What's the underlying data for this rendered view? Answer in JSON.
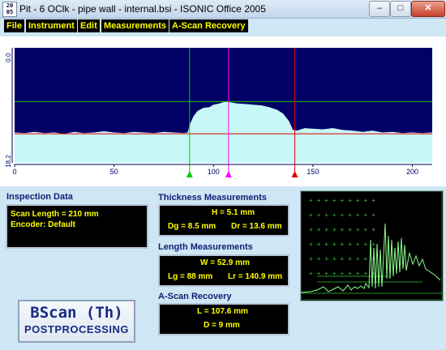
{
  "window": {
    "app_icon": "app-logo-icon",
    "title": "Pit - 6 OClk - pipe wall - internal.bsi - ISONIC Office 2005",
    "minimize": "–",
    "maximize": "□",
    "close": "✕"
  },
  "menu": [
    "File",
    "Instrument",
    "Edit",
    "Measurements",
    "A-Scan Recovery"
  ],
  "chart_data": {
    "type": "area",
    "x_ticks": [
      "0",
      "50",
      "100",
      "150",
      "200"
    ],
    "xlim": [
      0,
      210
    ],
    "y_ticks": [
      "0.0",
      "18.2"
    ],
    "ylim": [
      0,
      18.2
    ],
    "cursors": [
      {
        "name": "green",
        "x": 88,
        "color": "#00cc00"
      },
      {
        "name": "magenta",
        "x": 107.6,
        "color": "#ff00ff"
      },
      {
        "name": "red",
        "x": 140.9,
        "color": "#e00000"
      }
    ],
    "h_cursors": [
      {
        "name": "green",
        "y": 8.5,
        "color": "#00cc00"
      },
      {
        "name": "red",
        "y": 13.6,
        "color": "#e00000"
      }
    ],
    "colors": {
      "background": "#000066",
      "fill": "#c8f7f7"
    },
    "profile": [
      [
        0,
        13.4
      ],
      [
        5,
        13.5
      ],
      [
        10,
        13.3
      ],
      [
        15,
        13.5
      ],
      [
        20,
        13.4
      ],
      [
        25,
        13.6
      ],
      [
        30,
        13.3
      ],
      [
        35,
        13.5
      ],
      [
        40,
        13.4
      ],
      [
        45,
        13.2
      ],
      [
        50,
        13.4
      ],
      [
        55,
        13.5
      ],
      [
        60,
        13.3
      ],
      [
        65,
        13.4
      ],
      [
        70,
        13.5
      ],
      [
        75,
        13.3
      ],
      [
        80,
        13.4
      ],
      [
        85,
        13.5
      ],
      [
        87,
        13.4
      ],
      [
        88,
        12.2
      ],
      [
        90,
        10.8
      ],
      [
        92,
        10.0
      ],
      [
        95,
        9.5
      ],
      [
        98,
        9.4
      ],
      [
        100,
        9.0
      ],
      [
        103,
        8.8
      ],
      [
        106,
        8.5
      ],
      [
        108,
        8.6
      ],
      [
        112,
        8.8
      ],
      [
        116,
        8.9
      ],
      [
        120,
        9.0
      ],
      [
        124,
        9.1
      ],
      [
        128,
        9.4
      ],
      [
        132,
        9.8
      ],
      [
        135,
        10.4
      ],
      [
        138,
        11.6
      ],
      [
        140,
        13.0
      ],
      [
        142,
        13.1
      ],
      [
        146,
        12.7
      ],
      [
        150,
        12.8
      ],
      [
        155,
        12.9
      ],
      [
        160,
        12.7
      ],
      [
        165,
        13.0
      ],
      [
        170,
        13.1
      ],
      [
        175,
        13.3
      ],
      [
        180,
        13.1
      ],
      [
        185,
        13.4
      ],
      [
        190,
        13.3
      ],
      [
        195,
        13.5
      ],
      [
        200,
        13.4
      ],
      [
        205,
        13.5
      ],
      [
        210,
        13.4
      ]
    ]
  },
  "inspection": {
    "title": "Inspection Data",
    "scan_length": "Scan Length = 210 mm",
    "encoder": "Encoder: Default"
  },
  "thickness": {
    "title": "Thickness Measurements",
    "h": "H = 5.1 mm",
    "dg": "Dg = 8.5 mm",
    "dr": "Dr = 13.6 mm"
  },
  "length": {
    "title": "Length Measurements",
    "w": "W = 52.9 mm",
    "lg": "Lg = 88 mm",
    "lr": "Lr = 140.9 mm"
  },
  "ascan_recovery": {
    "title": "A-Scan Recovery",
    "l": "L = 107.6 mm",
    "d": "D = 9 mm"
  },
  "logo": {
    "line1": "BScan (Th)",
    "line2": "POSTPROCESSING"
  }
}
